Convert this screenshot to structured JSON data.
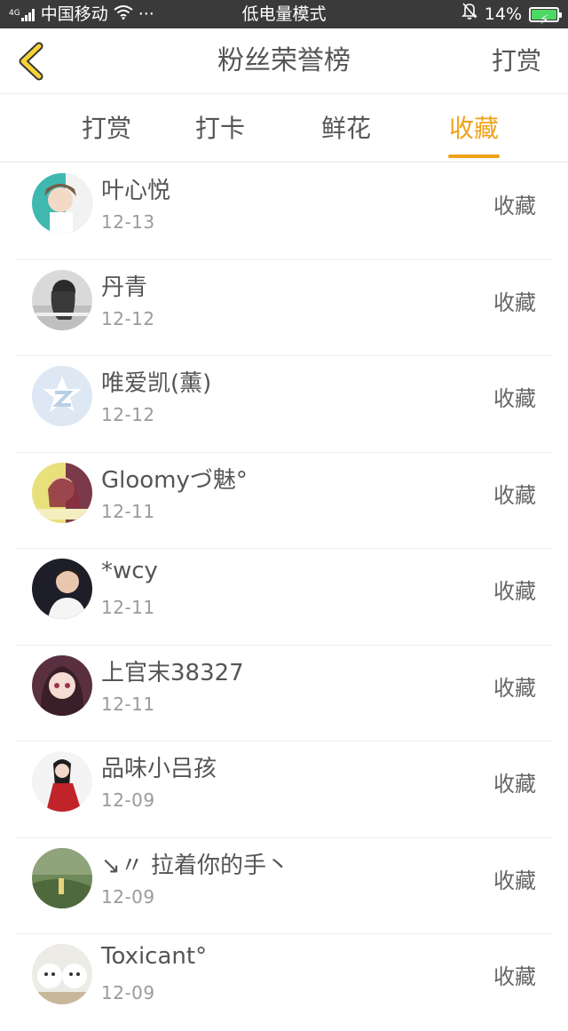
{
  "status_bar": {
    "network_type": "4G",
    "carrier": "中国移动",
    "more": "···",
    "mode": "低电量模式",
    "battery_percent": "14%",
    "battery_level": 0.14,
    "icons": [
      "signal-icon",
      "wifi-icon",
      "bell-off-icon",
      "battery-charging-icon"
    ]
  },
  "navbar": {
    "title": "粉丝荣誉榜",
    "right_action": "打赏",
    "back_icon": "chevron-left-icon",
    "accent_color": "#f0a21a"
  },
  "tabs": [
    {
      "label": "打赏",
      "active": false
    },
    {
      "label": "打卡",
      "active": false
    },
    {
      "label": "鲜花",
      "active": false
    },
    {
      "label": "收藏",
      "active": true
    }
  ],
  "fans": [
    {
      "name": "叶心悦",
      "date": "12-13",
      "action": "收藏"
    },
    {
      "name": "丹青",
      "date": "12-12",
      "action": "收藏"
    },
    {
      "name": "唯爱凯(薰)",
      "date": "12-12",
      "action": "收藏"
    },
    {
      "name": "Gloomyづ魅°",
      "date": "12-11",
      "action": "收藏"
    },
    {
      "name": "*wcy",
      "date": "12-11",
      "action": "收藏"
    },
    {
      "name": "上官末38327",
      "date": "12-11",
      "action": "收藏"
    },
    {
      "name": "品味小吕孩",
      "date": "12-09",
      "action": "收藏"
    },
    {
      "name": "↘〃 拉着你的手丶",
      "date": "12-09",
      "action": "收藏"
    },
    {
      "name": "Toxicant°",
      "date": "12-09",
      "action": "收藏"
    }
  ]
}
